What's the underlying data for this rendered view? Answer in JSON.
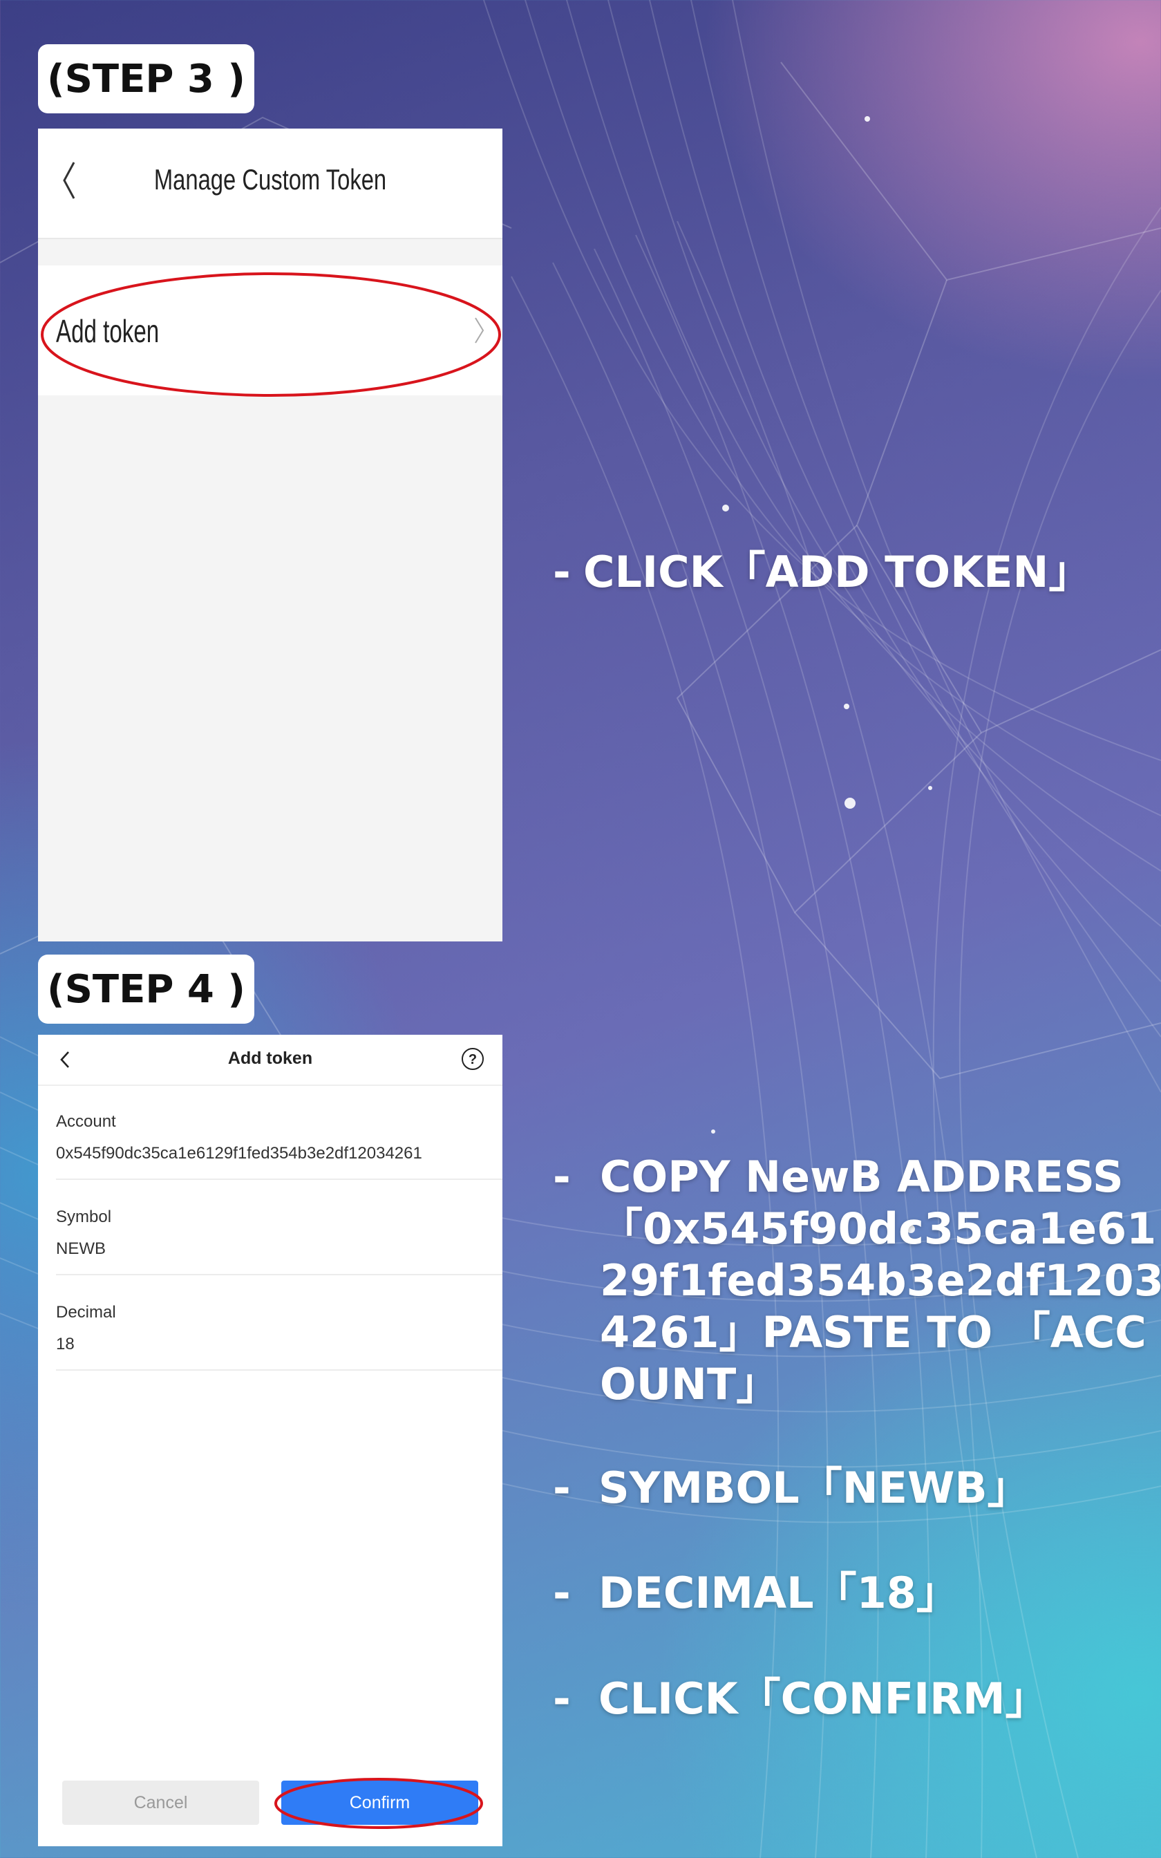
{
  "step3": {
    "badge": "(STEP 3 )",
    "title": "Manage Custom Token",
    "row_label": "Add token"
  },
  "step4": {
    "badge": "(STEP 4 )",
    "title": "Add token",
    "fields": [
      {
        "label": "Account",
        "value": "0x545f90dc35ca1e6129f1fed354b3e2df12034261"
      },
      {
        "label": "Symbol",
        "value": "NEWB"
      },
      {
        "label": "Decimal",
        "value": "18"
      }
    ],
    "cancel_label": "Cancel",
    "confirm_label": "Confirm"
  },
  "instructions": {
    "dash": "-",
    "add_token": "CLICK「ADD TOKEN」",
    "copy_address": "COPY NewB ADDRESS 「0x545f90dc35ca1e6129f1fed354b3e2df12034261」PASTE TO 「ACCOUNT」",
    "symbol": "SYMBOL「NEWB」",
    "decimal": "DECIMAL「18」",
    "confirm": "CLICK「CONFIRM」"
  },
  "colors": {
    "highlight_ellipse": "#d8141c",
    "confirm_blue": "#2f7cf6"
  }
}
